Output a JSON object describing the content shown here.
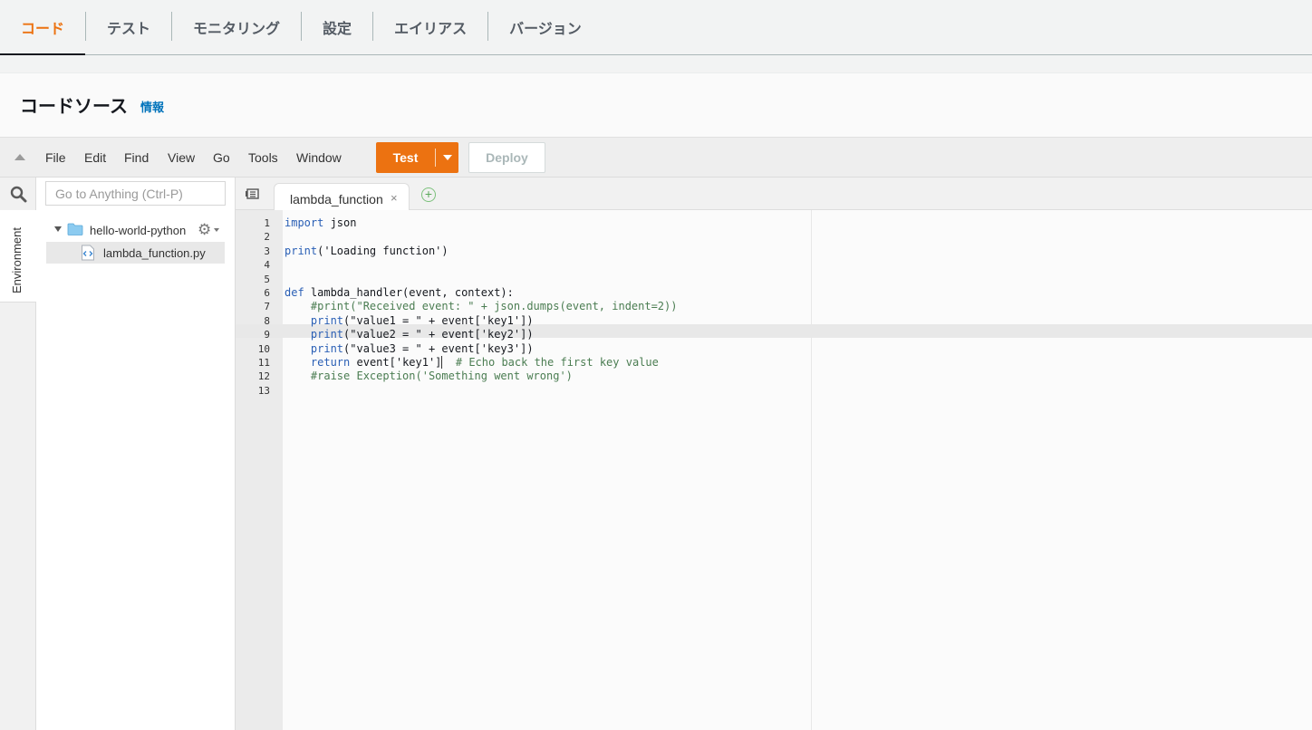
{
  "tabs": [
    {
      "label": "コード"
    },
    {
      "label": "テスト"
    },
    {
      "label": "モニタリング"
    },
    {
      "label": "設定"
    },
    {
      "label": "エイリアス"
    },
    {
      "label": "バージョン"
    }
  ],
  "header": {
    "title": "コードソース",
    "info_link": "情報"
  },
  "menubar": {
    "items": [
      "File",
      "Edit",
      "Find",
      "View",
      "Go",
      "Tools",
      "Window"
    ],
    "test_label": "Test",
    "deploy_label": "Deploy"
  },
  "sidebar": {
    "environment_label": "Environment",
    "search_placeholder": "Go to Anything (Ctrl-P)",
    "folder_name": "hello-world-python",
    "file_name": "lambda_function.py"
  },
  "editor": {
    "tab_label": "lambda_function",
    "tab_close": "×",
    "add_tab": "+",
    "active_line": 11,
    "lines": [
      {
        "num": "1",
        "code": "import json"
      },
      {
        "num": "2",
        "code": ""
      },
      {
        "num": "3",
        "code": "print('Loading function')"
      },
      {
        "num": "4",
        "code": ""
      },
      {
        "num": "5",
        "code": ""
      },
      {
        "num": "6",
        "code": "def lambda_handler(event, context):"
      },
      {
        "num": "7",
        "code": "    #print(\"Received event: \" + json.dumps(event, indent=2))"
      },
      {
        "num": "8",
        "code": "    print(\"value1 = \" + event['key1'])"
      },
      {
        "num": "9",
        "code": "    print(\"value2 = \" + event['key2'])"
      },
      {
        "num": "10",
        "code": "    print(\"value3 = \" + event['key3'])"
      },
      {
        "num": "11",
        "code": "    return event['key1']  # Echo back the first key value"
      },
      {
        "num": "12",
        "code": "    #raise Exception('Something went wrong')"
      },
      {
        "num": "13",
        "code": ""
      }
    ]
  }
}
